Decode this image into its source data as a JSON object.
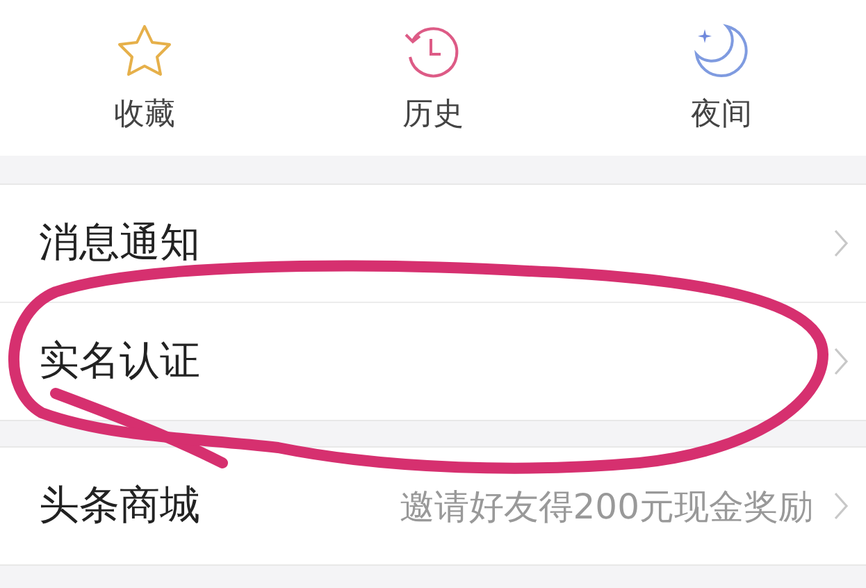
{
  "shortcuts": [
    {
      "kind": "star",
      "label": "收藏"
    },
    {
      "kind": "history",
      "label": "历史"
    },
    {
      "kind": "moon",
      "label": "夜间"
    }
  ],
  "sections": [
    {
      "items": [
        {
          "label": "消息通知"
        },
        {
          "label": "实名认证"
        }
      ]
    },
    {
      "items": [
        {
          "label": "头条商城",
          "detail": "邀请好友得200元现金奖励"
        }
      ]
    }
  ]
}
